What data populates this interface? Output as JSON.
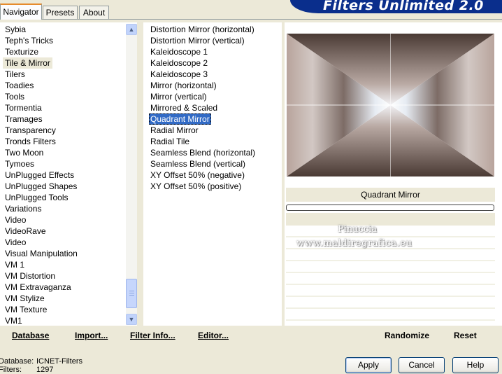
{
  "tabs": [
    {
      "label": "Navigator",
      "active": true
    },
    {
      "label": "Presets",
      "active": false
    },
    {
      "label": "About",
      "active": false
    }
  ],
  "app_title": "Filters Unlimited 2.0",
  "categories": [
    "Sybia",
    "Teph's Tricks",
    "Texturize",
    "Tile & Mirror",
    "Tilers",
    "Toadies",
    "Tools",
    "Tormentia",
    "Tramages",
    "Transparency",
    "Tronds Filters",
    "Two Moon",
    "Tymoes",
    "UnPlugged Effects",
    "UnPlugged Shapes",
    "UnPlugged Tools",
    "Variations",
    "Video",
    "VideoRave",
    "Video",
    "Visual Manipulation",
    "VM 1",
    "VM Distortion",
    "VM Extravaganza",
    "VM Stylize",
    "VM Texture",
    "VM1"
  ],
  "selected_category": "Tile & Mirror",
  "filters": [
    "Distortion Mirror (horizontal)",
    "Distortion Mirror (vertical)",
    "Kaleidoscope 1",
    "Kaleidoscope 2",
    "Kaleidoscope 3",
    "Mirror (horizontal)",
    "Mirror (vertical)",
    "Mirrored & Scaled",
    "Quadrant Mirror",
    "Radial Mirror",
    "Radial Tile",
    "Seamless Blend (horizontal)",
    "Seamless Blend (vertical)",
    "XY Offset 50% (negative)",
    "XY Offset 50% (positive)"
  ],
  "selected_filter": "Quadrant Mirror",
  "preview": {
    "filter_name": "Quadrant Mirror",
    "watermark_line1": "Pinuccia",
    "watermark_line2": "www.maldiregrafica.eu"
  },
  "links": {
    "database": "Database",
    "import": "Import...",
    "filter_info": "Filter Info...",
    "editor": "Editor...",
    "randomize": "Randomize",
    "reset": "Reset"
  },
  "status": {
    "database_label": "Database:",
    "database_value": "ICNET-Filters",
    "filters_label": "Filters:",
    "filters_value": "1297"
  },
  "buttons": {
    "apply": "Apply",
    "cancel": "Cancel",
    "help": "Help"
  },
  "colors": {
    "selection": "#316ac5",
    "banner": "#0a2e8c",
    "tab_accent": "#e68b2c"
  }
}
